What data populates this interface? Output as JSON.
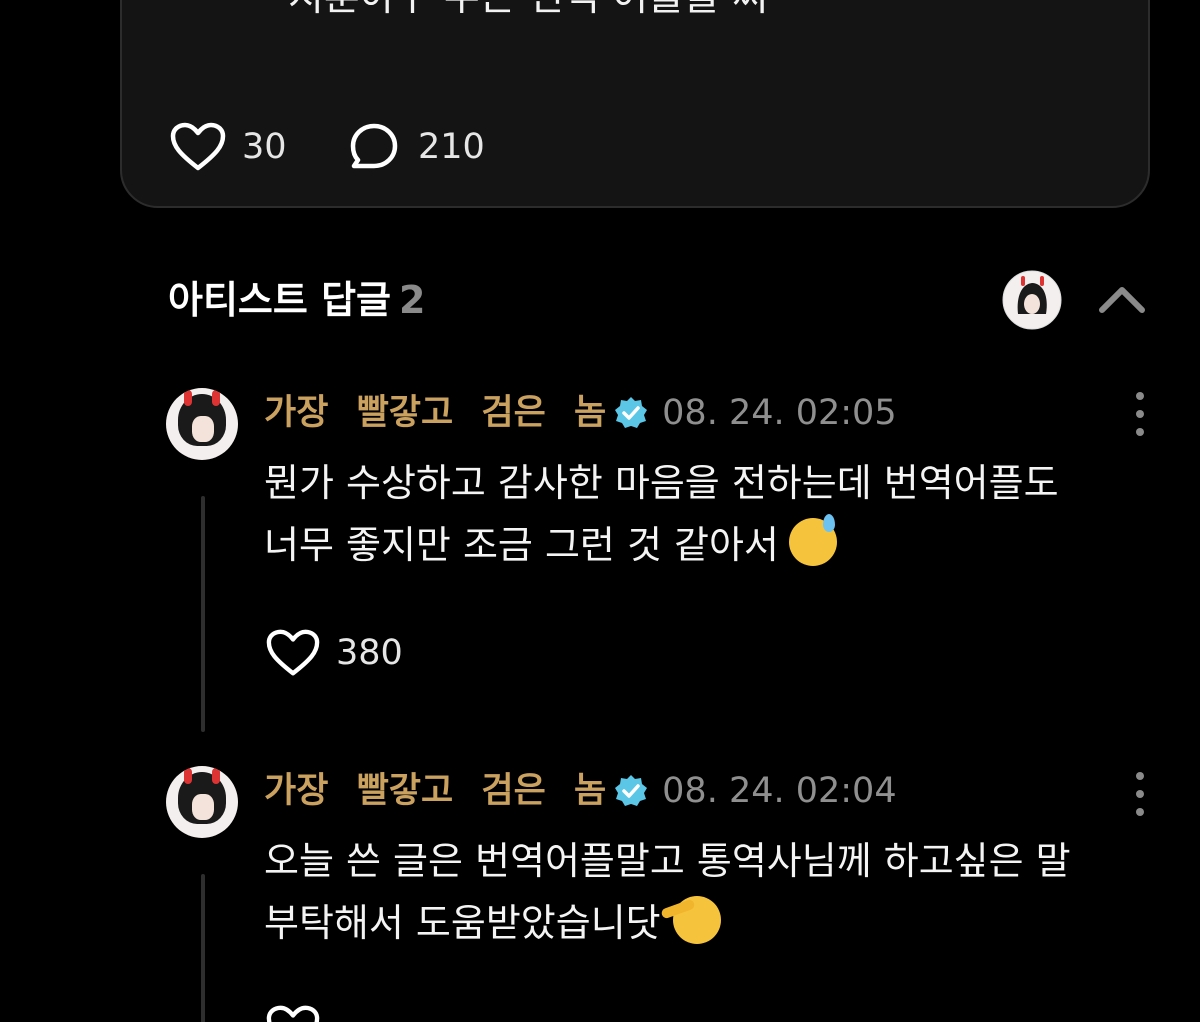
{
  "post": {
    "text": "지훈아ㅏ  무슨 번역 어플을 써",
    "likes": "30",
    "comments": "210"
  },
  "artist_replies": {
    "title": "아티스트 답글",
    "count": "2"
  },
  "replies": [
    {
      "author": "가장 빨갛고 검은 놈",
      "timestamp": "08. 24. 02:05",
      "text_line1": "뭔가 수상하고 감사한 마음을 전하는데 번역어플도",
      "text_line2": "너무 좋지만 조금 그런 것 같아서",
      "emoji": "grinning-sweat-emoji",
      "likes": "380"
    },
    {
      "author": "가장 빨갛고 검은 놈",
      "timestamp": "08. 24. 02:04",
      "text_line1": "오늘 쓴 글은 번역어플말고 통역사님께 하고싶은 말",
      "text_line2": "부탁해서 도움받았습니닷",
      "emoji": "saluting-face-emoji"
    }
  ],
  "colors": {
    "background": "#000000",
    "card": "#141414",
    "author": "#caa15e",
    "verified": "#5bc6e6",
    "muted": "#8f8f8f"
  }
}
